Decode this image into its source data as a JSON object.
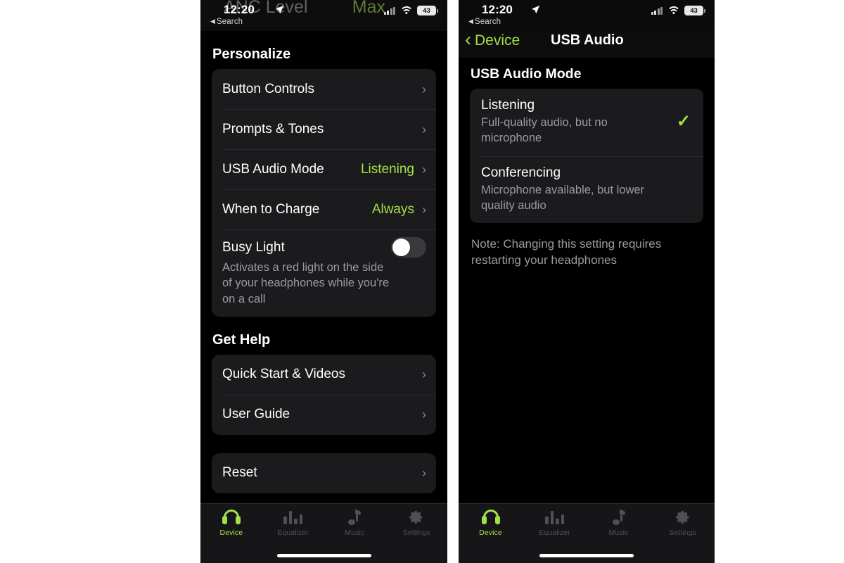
{
  "accent_green": "#a3e048",
  "background": "#000000",
  "card_background": "#1b1b1d",
  "page_background": "#ffffff",
  "status_bar": {
    "time": "12:20",
    "location_icon": "location-arrow-icon",
    "back_to_app_caret": "◀",
    "back_to_app_label": "Search",
    "signal_icon": "cellular-signal-icon",
    "wifi_icon": "wifi-icon",
    "battery_level": "43"
  },
  "left_phone": {
    "ghost_text_left": "ANC Level",
    "ghost_text_right": "Max",
    "sections": [
      {
        "title": "Personalize",
        "rows": [
          {
            "label": "Button Controls",
            "value": "",
            "type": "disclosure",
            "chevron": "›"
          },
          {
            "label": "Prompts & Tones",
            "value": "",
            "type": "disclosure",
            "chevron": "›"
          },
          {
            "label": "USB Audio Mode",
            "value": "Listening",
            "type": "disclosure",
            "chevron": "›"
          },
          {
            "label": "When to Charge",
            "value": "Always",
            "type": "disclosure",
            "chevron": "›"
          }
        ],
        "toggle_row": {
          "title": "Busy Light",
          "description": "Activates a red light on the side of your headphones while you're on a call",
          "state": "off"
        }
      },
      {
        "title": "Get Help",
        "rows": [
          {
            "label": "Quick Start & Videos",
            "value": "",
            "type": "disclosure",
            "chevron": "›"
          },
          {
            "label": "User Guide",
            "value": "",
            "type": "disclosure",
            "chevron": "›"
          }
        ]
      },
      {
        "title": "",
        "rows": [
          {
            "label": "Reset",
            "value": "",
            "type": "disclosure",
            "chevron": "›"
          }
        ]
      }
    ]
  },
  "right_phone": {
    "nav": {
      "back_chevron": "‹",
      "back_label": "Device",
      "title": "USB Audio"
    },
    "section_title": "USB Audio Mode",
    "options": [
      {
        "title": "Listening",
        "description": "Full-quality audio, but no microphone",
        "selected": true,
        "check_glyph": "✓"
      },
      {
        "title": "Conferencing",
        "description": "Microphone available, but lower quality audio",
        "selected": false,
        "check_glyph": "✓"
      }
    ],
    "note": "Note: Changing this setting requires restarting your headphones"
  },
  "tab_bar": {
    "tabs": [
      {
        "label": "Device",
        "icon": "headphones-icon",
        "active": true
      },
      {
        "label": "Equalizer",
        "icon": "equalizer-icon",
        "active": false
      },
      {
        "label": "Music",
        "icon": "music-note-icon",
        "active": false
      },
      {
        "label": "Settings",
        "icon": "gear-icon",
        "active": false
      }
    ]
  }
}
